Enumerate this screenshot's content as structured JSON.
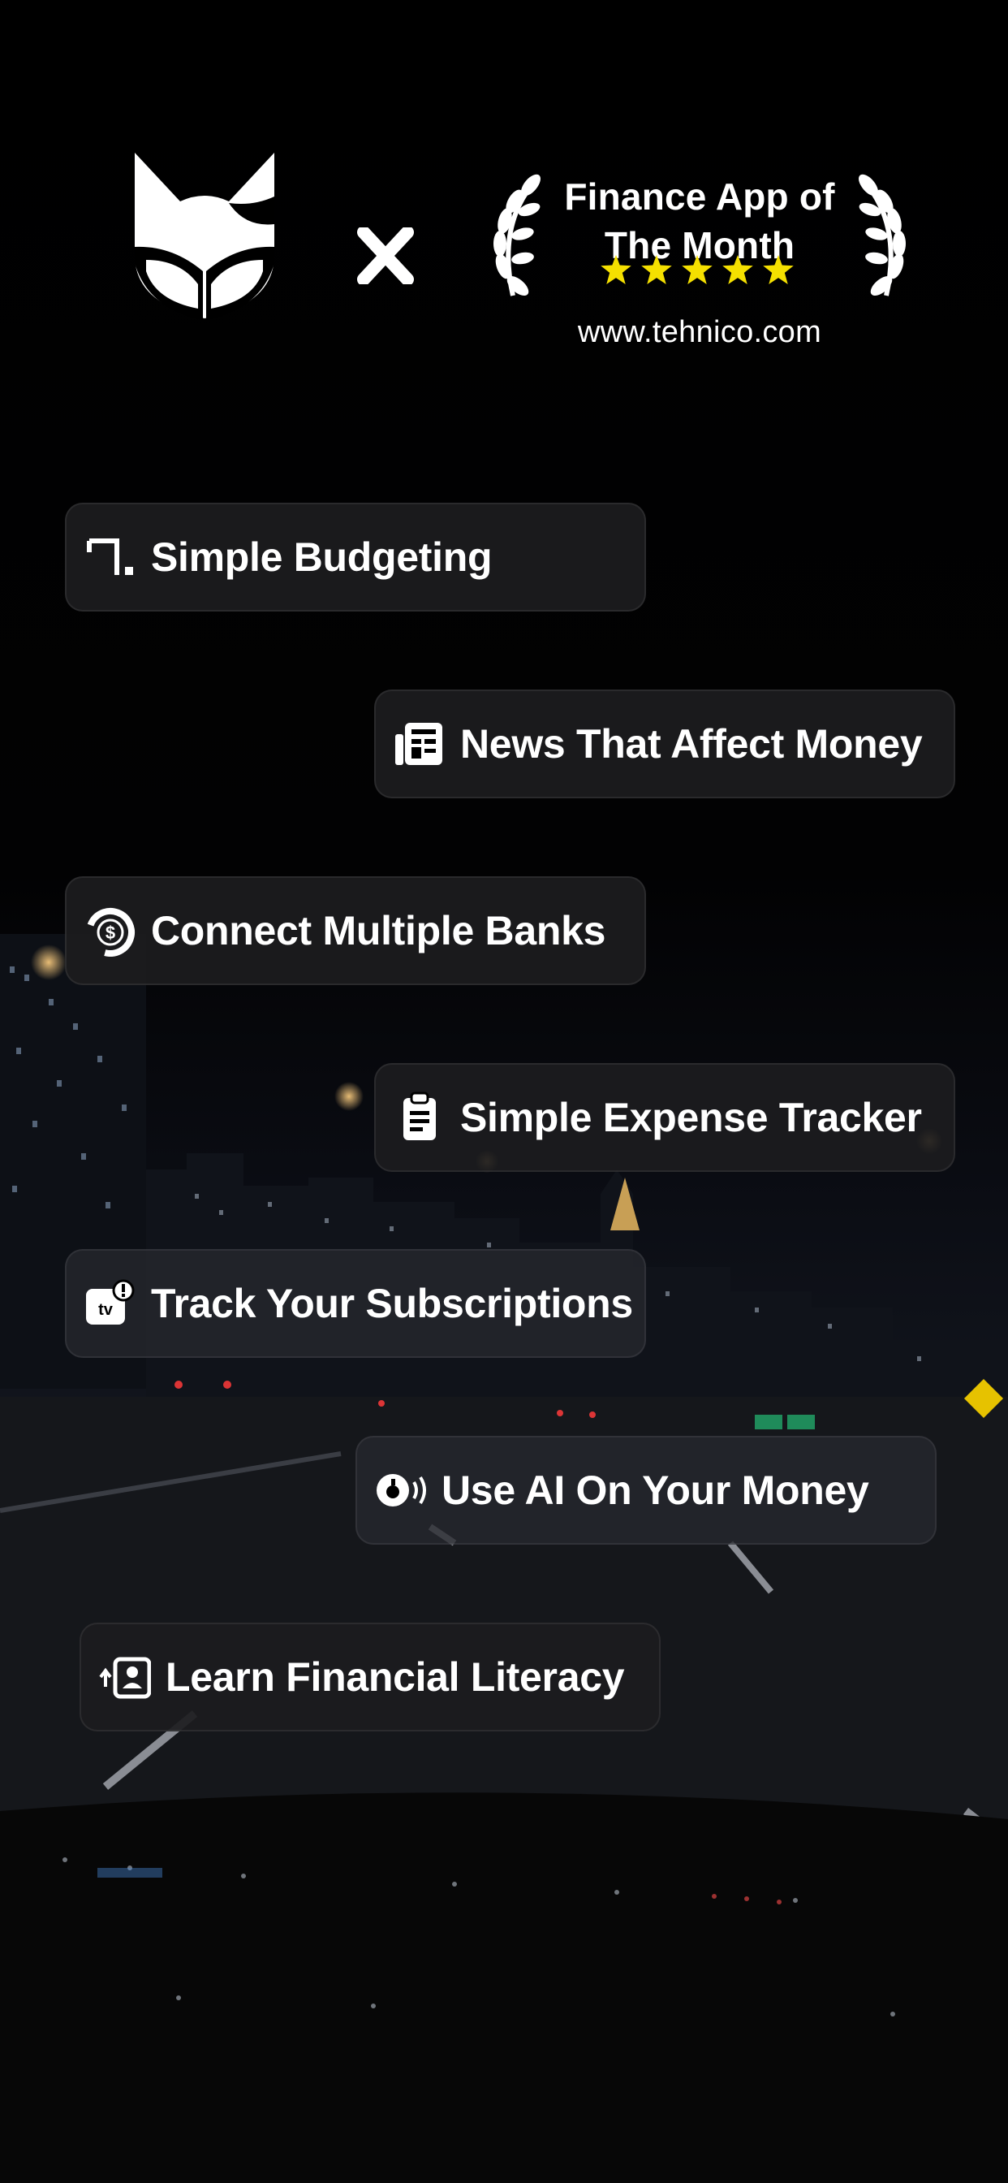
{
  "header": {
    "separator": "×",
    "award": {
      "title_line1": "Finance App of",
      "title_line2": "The Month",
      "stars": 5,
      "star_color": "#f5e000",
      "url": "www.tehnico.com"
    }
  },
  "features": [
    {
      "label": "Simple Budgeting",
      "icon": "budget-bracket-icon"
    },
    {
      "label": "News That Affect Money",
      "icon": "newspaper-icon"
    },
    {
      "label": "Connect Multiple Banks",
      "icon": "bank-dollar-icon"
    },
    {
      "label": "Simple Expense Tracker",
      "icon": "clipboard-icon"
    },
    {
      "label": "Track Your Subscriptions",
      "icon": "apple-tv-icon"
    },
    {
      "label": "Use AI On Your Money",
      "icon": "ai-voice-icon"
    },
    {
      "label": "Learn Financial Literacy",
      "icon": "contact-card-icon"
    }
  ],
  "colors": {
    "background": "#000000",
    "pill_background": "#1c1c1e",
    "text": "#ffffff",
    "accent_star": "#f5e000"
  }
}
